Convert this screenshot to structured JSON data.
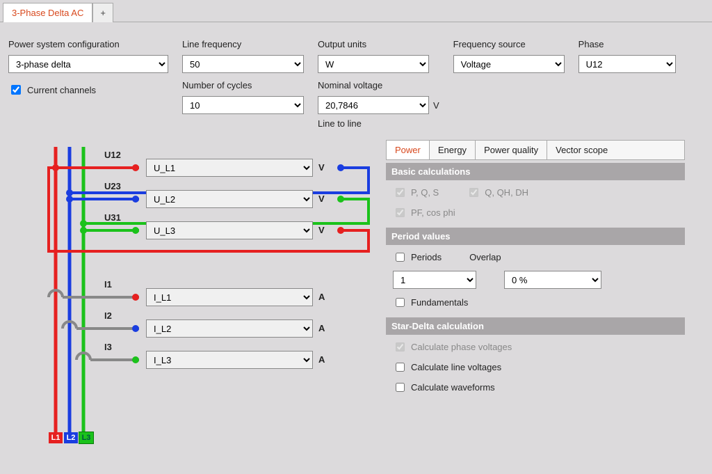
{
  "tabs": {
    "active": "3-Phase Delta AC",
    "add": "+"
  },
  "config": {
    "power_system": {
      "label": "Power system configuration",
      "value": "3-phase delta"
    },
    "current_channels": {
      "label": "Current channels",
      "checked": true
    },
    "line_freq": {
      "label": "Line frequency",
      "value": "50"
    },
    "num_cycles": {
      "label": "Number of cycles",
      "value": "10"
    },
    "output_units": {
      "label": "Output units",
      "value": "W"
    },
    "nom_voltage": {
      "label": "Nominal voltage",
      "value": "20,7846",
      "unit": "V",
      "note": "Line to line"
    },
    "freq_source": {
      "label": "Frequency source",
      "value": "Voltage"
    },
    "phase": {
      "label": "Phase",
      "value": "U12"
    }
  },
  "wiring": {
    "U12": {
      "label": "U12",
      "value": "U_L1",
      "unit": "V"
    },
    "U23": {
      "label": "U23",
      "value": "U_L2",
      "unit": "V"
    },
    "U31": {
      "label": "U31",
      "value": "U_L3",
      "unit": "V"
    },
    "I1": {
      "label": "I1",
      "value": "I_L1",
      "unit": "A"
    },
    "I2": {
      "label": "I2",
      "value": "I_L2",
      "unit": "A"
    },
    "I3": {
      "label": "I3",
      "value": "I_L3",
      "unit": "A"
    },
    "legs": {
      "L1": "L1",
      "L2": "L2",
      "L3": "L3"
    }
  },
  "rtabs": {
    "power": "Power",
    "energy": "Energy",
    "power_quality": "Power quality",
    "vector": "Vector scope"
  },
  "basic": {
    "h": "Basic calculations",
    "pqs": "P, Q, S",
    "pf": "PF, cos phi",
    "qqh": "Q, QH, DH"
  },
  "period": {
    "h": "Period values",
    "periods_l": "Periods",
    "periods_v": "1",
    "overlap_l": "Overlap",
    "overlap_v": "0 %",
    "fund_l": "Fundamentals"
  },
  "stardelta": {
    "h": "Star-Delta calculation",
    "phase_v": "Calculate phase voltages",
    "line_v": "Calculate line voltages",
    "wave": "Calculate waveforms"
  }
}
